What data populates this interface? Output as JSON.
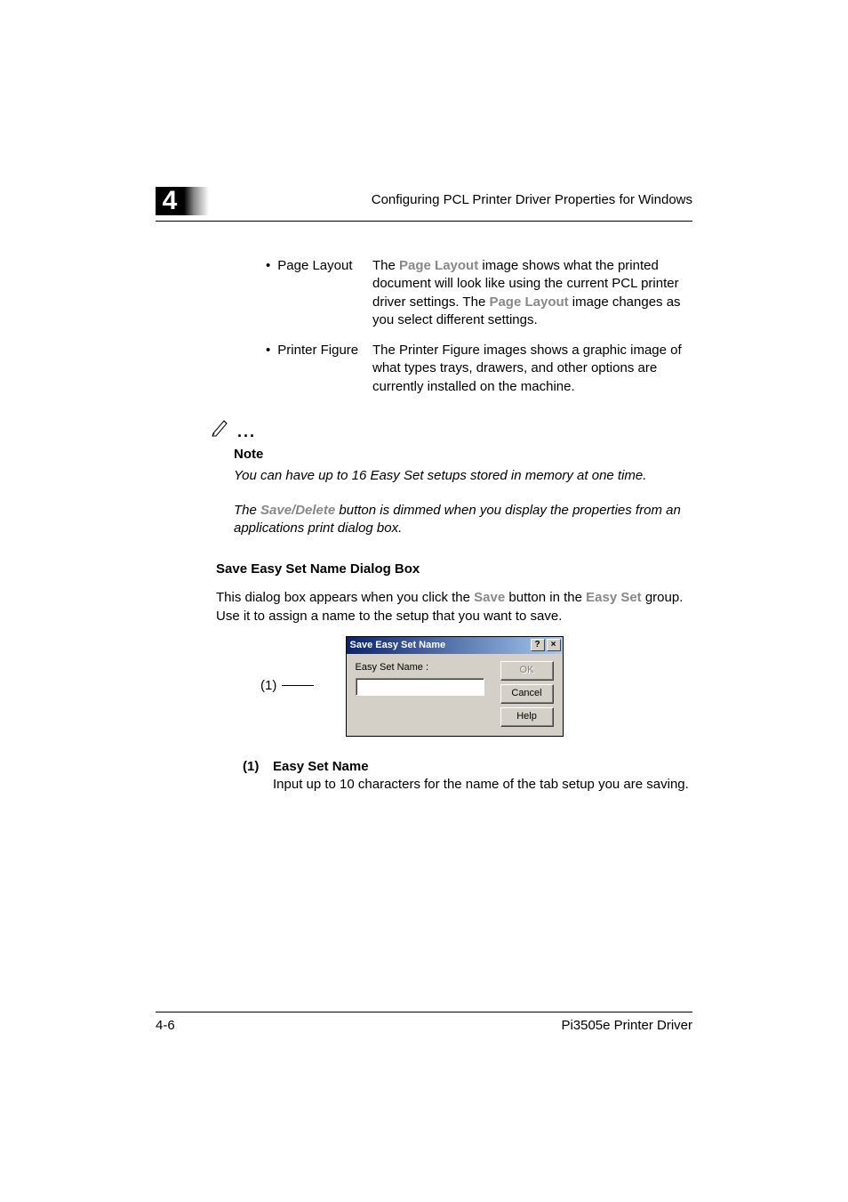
{
  "header": {
    "chapter_number": "4",
    "title": "Configuring PCL Printer Driver Properties for Windows"
  },
  "bullets": [
    {
      "label": "Page Layout",
      "desc_pre": "The ",
      "desc_bold1": "Page Layout",
      "desc_mid": " image shows what the printed document will look like using the current PCL printer driver settings. The ",
      "desc_bold2": "Page Layout",
      "desc_post": " image changes as you select different settings."
    },
    {
      "label": "Printer Figure",
      "desc_full": "The Printer Figure images shows a graphic image of what types trays, drawers, and other options are currently installed on the machine."
    }
  ],
  "note": {
    "label": "Note",
    "text1": "You can have up to 16 Easy Set setups stored in memory at one time.",
    "text2_pre": "The ",
    "text2_bold": "Save/Delete",
    "text2_post": " button is dimmed when you display the properties from an applications print dialog box."
  },
  "section": {
    "title": "Save Easy Set Name Dialog Box",
    "body_pre": "This dialog box appears when you click the ",
    "body_bold1": "Save",
    "body_mid": " button in the ",
    "body_bold2": "Easy Set",
    "body_post": " group. Use it to assign a name to the setup that you want to save."
  },
  "dialog": {
    "title": "Save Easy Set Name",
    "label": "Easy Set Name :",
    "input_value": "",
    "ok": "OK",
    "cancel": "Cancel",
    "help": "Help",
    "help_btn": "?",
    "close_btn": "×"
  },
  "callout": {
    "num": "(1)"
  },
  "definition": {
    "num": "(1)",
    "title": "Easy Set Name",
    "body": "Input up to 10 characters for the name of the tab setup you are saving."
  },
  "footer": {
    "page": "4-6",
    "product": "Pi3505e Printer Driver"
  }
}
